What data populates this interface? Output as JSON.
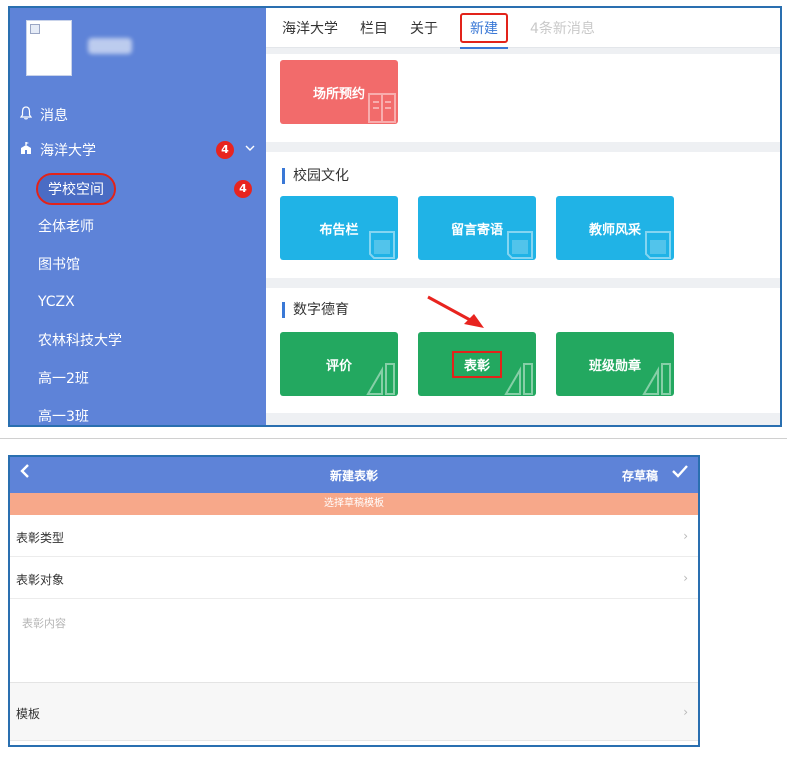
{
  "sidebar": {
    "messages_label": "消息",
    "school_label": "海洋大学",
    "school_badge": "4",
    "items": [
      {
        "label": "学校空间",
        "badge": "4"
      },
      {
        "label": "全体老师"
      },
      {
        "label": "图书馆"
      },
      {
        "label": "YCZX"
      },
      {
        "label": "农林科技大学"
      },
      {
        "label": "高一2班"
      },
      {
        "label": "高一3班"
      }
    ]
  },
  "topnav": {
    "tabs": [
      "海洋大学",
      "栏目",
      "关于",
      "新建"
    ],
    "messages": "4条新消息"
  },
  "sections": {
    "booking_tile": "场所预约",
    "campus_culture": {
      "title": "校园文化",
      "tiles": [
        "布告栏",
        "留言寄语",
        "教师风采"
      ]
    },
    "digital_moral": {
      "title": "数字德育",
      "tiles": [
        "评价",
        "表彰",
        "班级勋章"
      ]
    }
  },
  "mobile_form": {
    "title": "新建表彰",
    "save_draft": "存草稿",
    "banner": "选择草稿模板",
    "type_label": "表彰类型",
    "target_label": "表彰对象",
    "content_placeholder": "表彰内容",
    "template_label": "模板"
  },
  "colors": {
    "sidebar": "#5e83d8",
    "tile_red": "#f26b6b",
    "tile_blue": "#20b3e6",
    "tile_green": "#23a860",
    "banner": "#f7a88a",
    "highlight": "#e2231a",
    "arrow": "#e8241f"
  }
}
